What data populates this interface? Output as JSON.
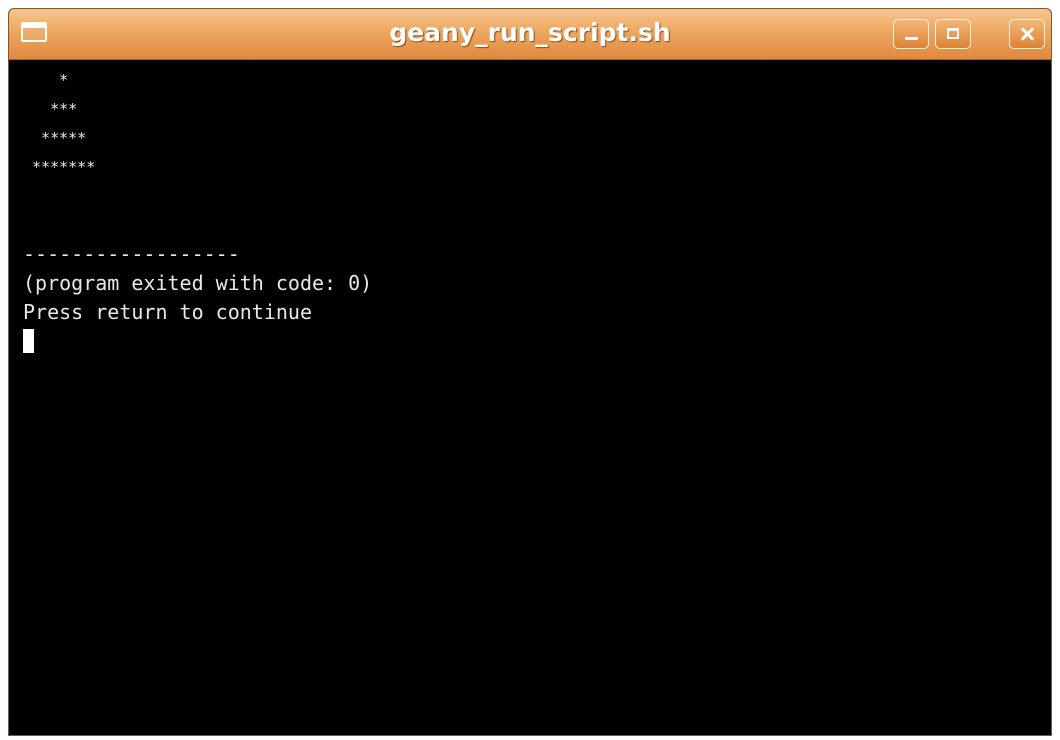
{
  "window": {
    "title": "geany_run_script.sh"
  },
  "icons": {
    "window_menu": "window-menu-icon",
    "minimize": "minimize-icon",
    "maximize": "maximize-icon",
    "close": "close-icon"
  },
  "terminal": {
    "lines": [
      "    *",
      "   ***",
      "  *****",
      " *******",
      "",
      "",
      "------------------",
      "(program exited with code: 0)",
      "Press return to continue"
    ]
  },
  "colors": {
    "titlebar": "#e99a50",
    "terminal_bg": "#000000",
    "terminal_fg": "#e8e8e8"
  }
}
